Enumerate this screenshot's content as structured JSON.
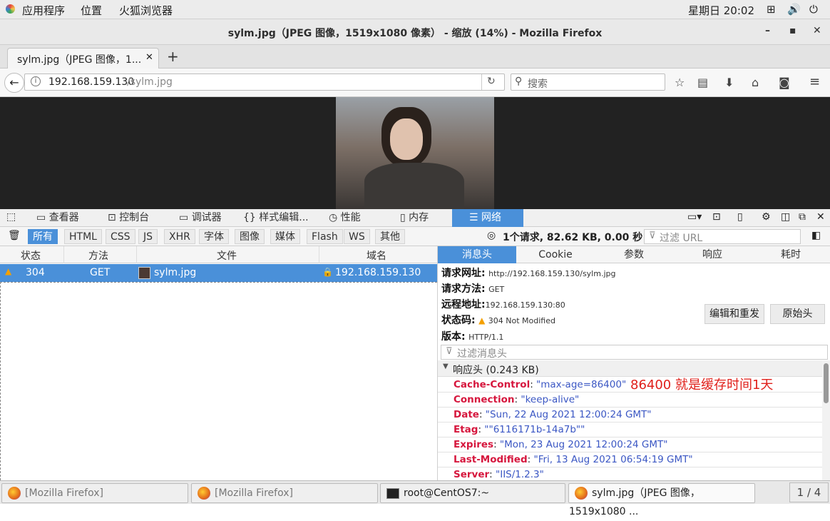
{
  "topbar": {
    "apps": "应用程序",
    "places": "位置",
    "browser": "火狐浏览器",
    "clock": "星期日 20:02"
  },
  "window": {
    "title": "sylm.jpg（JPEG 图像，1519x1080 像素） - 缩放 (14%) - Mozilla Firefox",
    "minimize": "–",
    "maximize": "▪",
    "close": "✕"
  },
  "tab": {
    "label": "sylm.jpg（JPEG 图像，1...",
    "close": "✕",
    "new": "+"
  },
  "navbar": {
    "url_host": "192.168.159.130",
    "url_path": "/sylm.jpg",
    "search_placeholder": "搜索"
  },
  "devtools": {
    "tabs": [
      "查看器",
      "控制台",
      "调试器",
      "样式编辑...",
      "性能",
      "内存",
      "网络"
    ],
    "filters": [
      "所有",
      "HTML",
      "CSS",
      "JS",
      "XHR",
      "字体",
      "图像",
      "媒体",
      "Flash",
      "WS",
      "其他"
    ],
    "summary": "1个请求, 82.62 KB, 0.00 秒",
    "filter_url_placeholder": "过滤 URL",
    "columns": [
      "状态",
      "方法",
      "文件",
      "域名"
    ],
    "request": {
      "status": "304",
      "method": "GET",
      "file": "sylm.jpg",
      "domain": "192.168.159.130"
    }
  },
  "detail": {
    "tabs": [
      "消息头",
      "Cookie",
      "参数",
      "响应",
      "耗时"
    ],
    "req_url_label": "请求网址:",
    "req_url": "http://192.168.159.130/sylm.jpg",
    "req_method_label": "请求方法:",
    "req_method": "GET",
    "remote_label": "远程地址:",
    "remote": "192.168.159.130:80",
    "status_label": "状态码:",
    "status": "304 Not Modified",
    "version_label": "版本:",
    "version": "HTTP/1.1",
    "edit_resend": "编辑和重发",
    "raw_headers": "原始头",
    "filter_headers_placeholder": "过滤消息头",
    "response_section": "响应头 (0.243 KB)",
    "annotation": "86400 就是缓存时间1天",
    "headers": [
      {
        "name": "Cache-Control",
        "value": "\"max-age=86400\""
      },
      {
        "name": "Connection",
        "value": "\"keep-alive\""
      },
      {
        "name": "Date",
        "value": "\"Sun, 22 Aug 2021 12:00:24 GMT\""
      },
      {
        "name": "Etag",
        "value": "\"\"6116171b-14a7b\"\""
      },
      {
        "name": "Expires",
        "value": "\"Mon, 23 Aug 2021 12:00:24 GMT\""
      },
      {
        "name": "Last-Modified",
        "value": "\"Fri, 13 Aug 2021 06:54:19 GMT\""
      },
      {
        "name": "Server",
        "value": "\"IIS/1.2.3\""
      }
    ]
  },
  "taskbar": {
    "items": [
      "[Mozilla Firefox]",
      "[Mozilla Firefox]",
      "root@CentOS7:~",
      "sylm.jpg（JPEG 图像，1519x1080 ..."
    ],
    "pager": "1 / 4"
  }
}
